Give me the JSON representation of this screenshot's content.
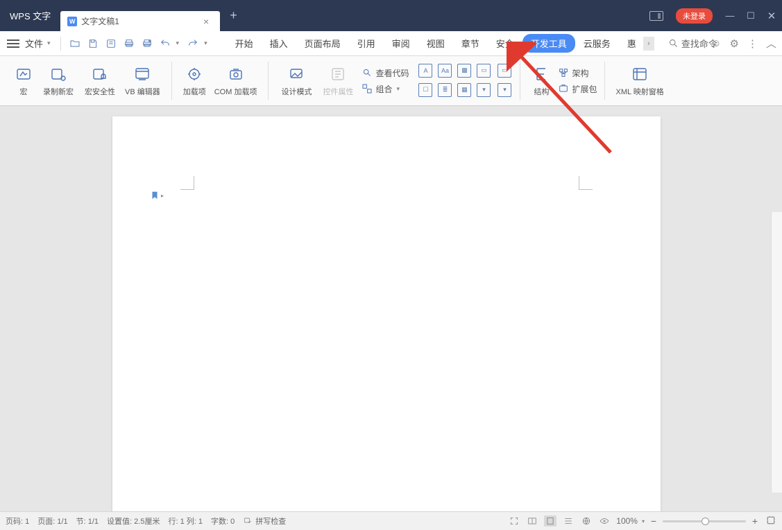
{
  "app": {
    "name": "WPS 文字"
  },
  "tab": {
    "label": "文字文稿1"
  },
  "login": {
    "label": "未登录"
  },
  "file_menu": {
    "label": "文件"
  },
  "menu": {
    "items": [
      "开始",
      "插入",
      "页面布局",
      "引用",
      "审阅",
      "视图",
      "章节",
      "安全",
      "开发工具",
      "云服务",
      "惠"
    ],
    "active_index": 8,
    "overflow_glyph": "›"
  },
  "search": {
    "label": "查找命令"
  },
  "ribbon": {
    "macro": "宏",
    "record_macro": "录制新宏",
    "macro_security": "宏安全性",
    "vb_editor": "VB 编辑器",
    "addins": "加载项",
    "com_addins": "COM 加载项",
    "design_mode": "设计模式",
    "control_props": "控件属性",
    "view_code": "查看代码",
    "group": "组合",
    "structure": "结构",
    "schema": "架构",
    "extension": "扩展包",
    "xml_map": "XML 映射窗格"
  },
  "status": {
    "page_no": "页码: 1",
    "page": "页面: 1/1",
    "section": "节: 1/1",
    "setting": "设置值: 2.5厘米",
    "row_col": "行: 1  列: 1",
    "words": "字数: 0",
    "spell": "拼写检查",
    "zoom": "100%"
  }
}
